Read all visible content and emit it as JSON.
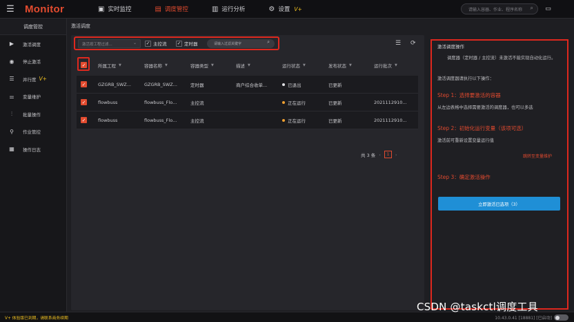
{
  "app": {
    "logo": "Monitor",
    "menu_icon": "hamburger-icon"
  },
  "topnav": [
    {
      "label": "实时监控",
      "icon": "monitor-icon",
      "active": false
    },
    {
      "label": "调度管控",
      "icon": "schedule-icon",
      "active": true
    },
    {
      "label": "运行分析",
      "icon": "analysis-icon",
      "active": false
    },
    {
      "label": "设置",
      "icon": "gear-icon",
      "active": false,
      "badge": "V+"
    }
  ],
  "search": {
    "placeholder": "请输入容器、作业、程序名称"
  },
  "sidebar": {
    "title": "调度管控",
    "items": [
      {
        "label": "激活调度",
        "icon": "play-icon"
      },
      {
        "label": "停止激活",
        "icon": "stop-circle-icon"
      },
      {
        "label": "并行度",
        "icon": "parallel-icon",
        "badge": "V+"
      },
      {
        "label": "变量维护",
        "icon": "sliders-icon"
      },
      {
        "label": "批量操作",
        "icon": "batch-icon"
      },
      {
        "label": "作业管控",
        "icon": "job-control-icon"
      },
      {
        "label": "操作日志",
        "icon": "log-icon"
      }
    ]
  },
  "breadcrumb": "激活调度",
  "filters": {
    "project_placeholder": "激活按工程过滤...",
    "main_flow": "主控流",
    "timer": "定时器",
    "keyword_placeholder": "请输入过滤关键字"
  },
  "table": {
    "headers": [
      "所属工程",
      "容器名称",
      "容器类型",
      "描述",
      "运行状态",
      "发布状态",
      "运行批次"
    ],
    "rows": [
      {
        "project": "GZGRB_SWZ...",
        "container": "GZGRB_SWZ...",
        "type": "定时器",
        "desc": "商户综合收单...",
        "status": "已退出",
        "status_color": "#e0e0e4",
        "publish": "已更新",
        "batch": ""
      },
      {
        "project": "flowbuss",
        "container": "flowbuss_Flo...",
        "type": "主控流",
        "desc": "",
        "status": "正在运行",
        "status_color": "#f0a030",
        "publish": "已更新",
        "batch": "2021112910..."
      },
      {
        "project": "flowbuss",
        "container": "flowbuss_Flo...",
        "type": "主控流",
        "desc": "",
        "status": "正在运行",
        "status_color": "#f0a030",
        "publish": "已更新",
        "batch": "2021112910..."
      }
    ]
  },
  "pager": {
    "total": "共 3 条",
    "page": "1"
  },
  "right": {
    "title": "激活调度操作",
    "desc": "调度器（定时器 / 主控流）未激活不能实现自动化运行。",
    "intro": "激活调度器请执行以下操作：",
    "step1": "Step 1：选择要激活的容器",
    "step1_desc": "从左边表格中选择需要激活的调度器，也可以多选",
    "step2": "Step 2：初始化运行变量（该项可选）",
    "step2_desc": "激活前可重新设置变量运行值",
    "step2_link": "跳转至变量维护",
    "step3": "Step 3：确定激活操作",
    "button": "立即激活已选项（3）"
  },
  "footer": {
    "notice": "V+ 体验版已到期，请联系商务续期",
    "version": "10.43.0.41 [18881]  [已启动]"
  },
  "watermark": "CSDN @taskctl调度工具"
}
